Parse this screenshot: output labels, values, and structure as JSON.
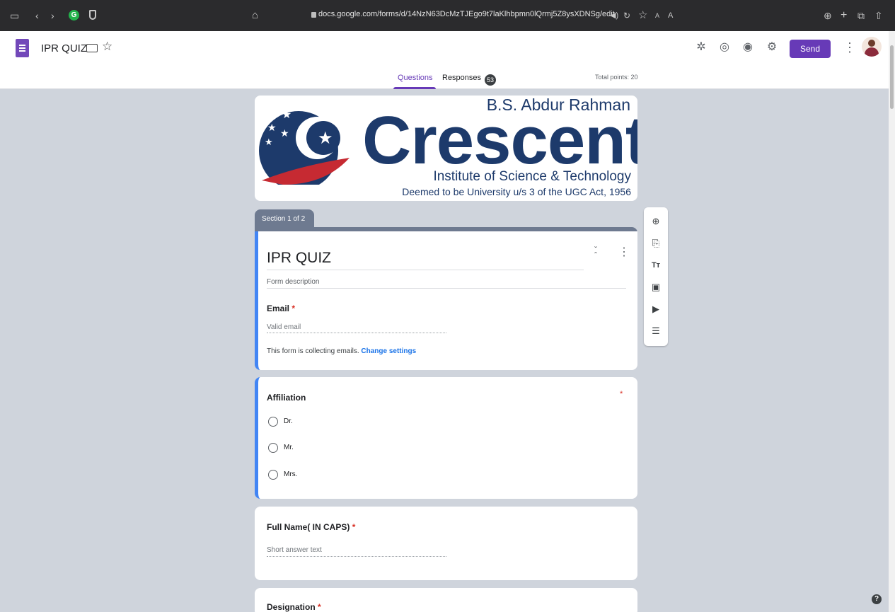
{
  "browser": {
    "url": "docs.google.com/forms/d/14NzN63DcMzTJEgo9t7laKlhbpmn0lQrmj5Z8ysXDNSg/edit",
    "extension_badge": "G",
    "reader_text_small": "A",
    "reader_text_large": "A"
  },
  "header": {
    "doc_title": "IPR QUIZ",
    "send_label": "Send",
    "tabs": [
      {
        "label": "Questions",
        "active": true
      },
      {
        "label": "Responses",
        "count": "53"
      }
    ],
    "total_points": "Total points: 20",
    "icons": [
      "addon-icon",
      "palette-icon",
      "preview-icon",
      "settings-icon"
    ]
  },
  "banner": {
    "line1": "B.S. Abdur Rahman",
    "line2": "Crescent",
    "line3": "Institute of Science & Technology",
    "line4": "Deemed to be University u/s 3 of the UGC Act, 1956"
  },
  "section": {
    "label": "Section 1 of 2"
  },
  "form": {
    "title": "IPR QUIZ",
    "description_placeholder": "Form description",
    "email": {
      "label": "Email",
      "required_mark": "*",
      "placeholder": "Valid email",
      "note": "This form is collecting emails.",
      "note_link": "Change settings"
    }
  },
  "questions": [
    {
      "label": "Affiliation",
      "required_mark": "*",
      "options": [
        "Dr.",
        "Mr.",
        "Mrs."
      ]
    },
    {
      "label": "Full Name( IN CAPS)",
      "required_mark": "*",
      "placeholder": "Short answer text"
    },
    {
      "label": "Designation",
      "required_mark": "*"
    }
  ],
  "colors": {
    "accent": "#673ab7",
    "focus": "#4285f4",
    "section": "#6e7a90",
    "page_bg": "#cfd4dc"
  }
}
